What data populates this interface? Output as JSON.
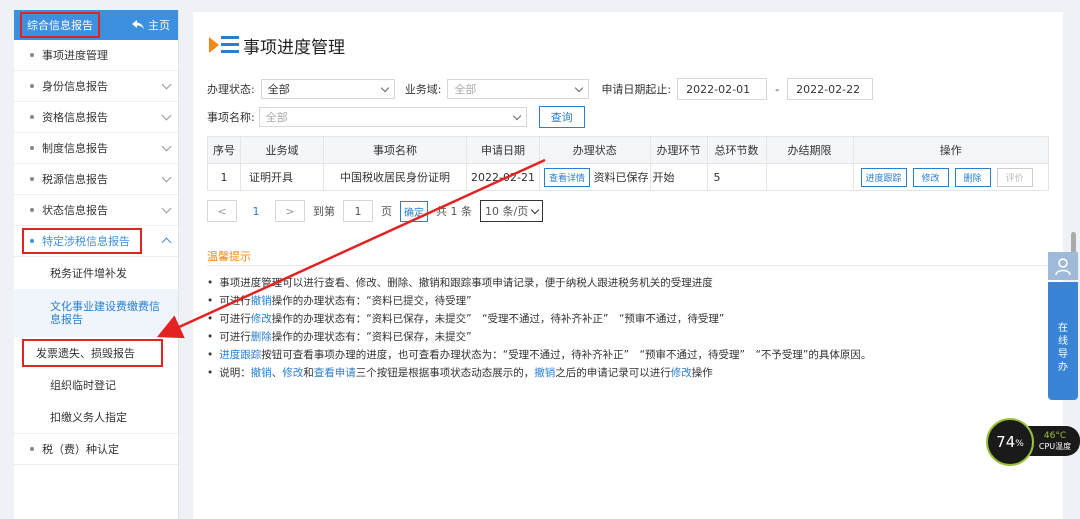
{
  "sidebar": {
    "header_title": "综合信息报告",
    "home_label": "主页",
    "items": [
      {
        "label": "事项进度管理"
      },
      {
        "label": "身份信息报告"
      },
      {
        "label": "资格信息报告"
      },
      {
        "label": "制度信息报告"
      },
      {
        "label": "税源信息报告"
      },
      {
        "label": "状态信息报告"
      },
      {
        "label": "特定涉税信息报告"
      }
    ],
    "sub_items": [
      {
        "label": "税务证件增补发"
      },
      {
        "label": "文化事业建设费缴费信息报告"
      },
      {
        "label": "发票遗失、损毁报告"
      },
      {
        "label": "组织临时登记"
      },
      {
        "label": "扣缴义务人指定"
      }
    ],
    "last_item": {
      "label": "税（费）种认定"
    }
  },
  "page": {
    "title": "事项进度管理"
  },
  "form": {
    "status_label": "办理状态:",
    "status_value": "全部",
    "domain_label": "业务域:",
    "domain_placeholder": "全部",
    "date_label": "申请日期起止:",
    "date_start": "2022-02-01",
    "date_sep": "-",
    "date_end": "2022-02-22",
    "item_label": "事项名称:",
    "item_placeholder": "全部",
    "query_button": "查询"
  },
  "table": {
    "headers": [
      "序号",
      "业务域",
      "事项名称",
      "申请日期",
      "办理状态",
      "办理环节",
      "总环节数",
      "办结期限",
      "操作"
    ],
    "rows": [
      {
        "index": "1",
        "domain": "证明开具",
        "item": "中国税收居民身份证明",
        "date": "2022-02-21",
        "status_btn": "查看详情",
        "status": "资料已保存",
        "stage": "开始",
        "total": "5",
        "deadline": "",
        "ops": [
          "进度跟踪",
          "修改",
          "删除",
          "评价"
        ]
      }
    ]
  },
  "pager": {
    "prev": "<",
    "current": "1",
    "next": ">",
    "goto_label": "到第",
    "goto_value": "1",
    "page_unit": "页",
    "confirm": "确定",
    "total": "共 1 条",
    "page_size": "10 条/页"
  },
  "tips": {
    "title": "温馨提示",
    "lines": [
      {
        "parts": [
          {
            "t": "事项进度管理可以进行查看、修改、删除、撤销和跟踪事项申请记录，便于纳税人跟进税务机关的受理进度"
          }
        ]
      },
      {
        "parts": [
          {
            "t": "可进行"
          },
          {
            "t": "撤销",
            "link": true
          },
          {
            "t": "操作的办理状态有：“资料已提交，待受理”"
          }
        ]
      },
      {
        "parts": [
          {
            "t": "可进行"
          },
          {
            "t": "修改",
            "link": true
          },
          {
            "t": "操作的办理状态有：“资料已保存，未提交”　“受理不通过，待补齐补正”　“预审不通过，待受理”"
          }
        ]
      },
      {
        "parts": [
          {
            "t": "可进行"
          },
          {
            "t": "删除",
            "link": true
          },
          {
            "t": "操作的办理状态有：“资料已保存，未提交”"
          }
        ]
      },
      {
        "parts": [
          {
            "t": "进度跟踪",
            "link": true
          },
          {
            "t": "按钮可查看事项办理的进度，也可查看办理状态为：“受理不通过，待补齐补正”　“预审不通过，待受理”　“不予受理”的具体原因。"
          }
        ]
      },
      {
        "parts": [
          {
            "t": "说明："
          },
          {
            "t": "撤销",
            "link": true
          },
          {
            "t": "、"
          },
          {
            "t": "修改",
            "link": true
          },
          {
            "t": "和"
          },
          {
            "t": "查看申请",
            "link": true
          },
          {
            "t": "三个按钮是根据事项状态动态展示的，"
          },
          {
            "t": "撤销",
            "link": true
          },
          {
            "t": "之后的申请记录可以进行"
          },
          {
            "t": "修改",
            "link": true
          },
          {
            "t": "操作"
          }
        ]
      }
    ]
  },
  "float_panel": {
    "text": [
      "在",
      "线",
      "导",
      "办"
    ]
  },
  "cpu": {
    "percent": "74",
    "percent_unit": "%",
    "temp": "46°C",
    "label": "CPU温度"
  },
  "colors": {
    "accent": "#2a7ed0",
    "highlight_red": "#e32222",
    "tips_orange": "#f08a12"
  }
}
